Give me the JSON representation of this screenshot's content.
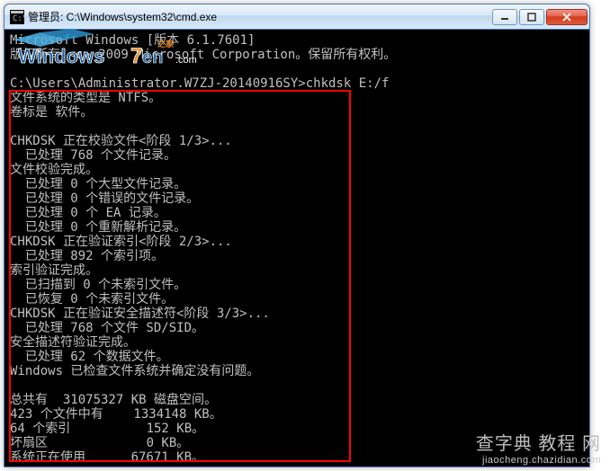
{
  "window": {
    "title": "管理员: C:\\Windows\\system32\\cmd.exe"
  },
  "terminal": {
    "lines": [
      "Microsoft Windows [版本 6.1.7601]",
      "版权所有 <c> 2009 Microsoft Corporation。保留所有权利。",
      "",
      "C:\\Users\\Administrator.W7ZJ-20140916SY>chkdsk E:/f",
      "文件系统的类型是 NTFS。",
      "卷标是 软件。",
      "",
      "CHKDSK 正在校验文件<阶段 1/3>...",
      "  已处理 768 个文件记录。",
      "文件校验完成。",
      "  已处理 0 个大型文件记录。",
      "  已处理 0 个错误的文件记录。",
      "  已处理 0 个 EA 记录。",
      "  已处理 0 个重新解析记录。",
      "CHKDSK 正在验证索引<阶段 2/3>...",
      "  已处理 892 个索引项。",
      "索引验证完成。",
      "  已扫描到 0 个未索引文件。",
      "  已恢复 0 个未索引文件。",
      "CHKDSK 正在验证安全描述符<阶段 3/3>...",
      "  已处理 768 个文件 SD/SID。",
      "安全描述符验证完成。",
      "  已处理 62 个数据文件。",
      "Windows 已检查文件系统并确定没有问题。",
      "",
      "总共有  31075327 KB 磁盘空间。",
      "423 个文件中有    1334148 KB。",
      "64 个索引          152 KB。",
      "坏扇区             0 KB。",
      "系统正在使用      67671 KB。"
    ]
  },
  "watermark": {
    "footer_main": "查字典 教程 网",
    "footer_sub": "jiaocheng.chazidian.com"
  }
}
